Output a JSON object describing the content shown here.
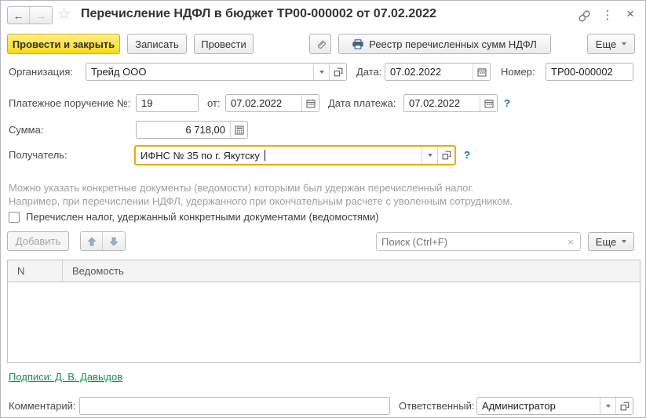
{
  "window": {
    "title": "Перечисление НДФЛ в бюджет ТР00-000002 от 07.02.2022"
  },
  "icons": {
    "back": "←",
    "forward": "→",
    "star": "☆",
    "menu": "⋮",
    "close": "×",
    "help": "?",
    "clear": "×"
  },
  "toolbar": {
    "post_and_close": "Провести и закрыть",
    "write": "Записать",
    "post": "Провести",
    "register_report": "Реестр перечисленных сумм НДФЛ",
    "more": "Еще"
  },
  "fields": {
    "organization": {
      "label": "Организация:",
      "value": "Трейд ООО"
    },
    "date": {
      "label": "Дата:",
      "value": "07.02.2022"
    },
    "number": {
      "label": "Номер:",
      "value": "ТР00-000002"
    },
    "payment_order": {
      "label": "Платежное поручение №:",
      "value": "19"
    },
    "from": {
      "label": "от:",
      "value": "07.02.2022"
    },
    "payment_date": {
      "label": "Дата платежа:",
      "value": "07.02.2022"
    },
    "sum": {
      "label": "Сумма:",
      "value": "6 718,00"
    },
    "recipient": {
      "label": "Получатель:",
      "value": "ИФНС № 35 по г. Якутску"
    },
    "comment": {
      "label": "Комментарий:",
      "value": ""
    },
    "responsible": {
      "label": "Ответственный:",
      "value": "Администратор"
    }
  },
  "info": {
    "line1": "Можно указать конкретные документы (ведомости) которыми был удержан перечисленный налог.",
    "line2": "Например, при перечислении НДФЛ, удержанного при окончательным расчете с уволенным сотрудником."
  },
  "checkbox": {
    "label": "Перечислен налог, удержанный конкретными документами (ведомостями)",
    "checked": false
  },
  "list_section": {
    "add": "Добавить",
    "search_placeholder": "Поиск (Ctrl+F)",
    "more": "Еще"
  },
  "table": {
    "columns": [
      "N",
      "Ведомость"
    ],
    "rows": []
  },
  "signatures": {
    "text": "Подписи: Д. В. Давыдов"
  },
  "colors": {
    "primary_button": "#ffd912",
    "focus_border": "#eeac00",
    "link_green": "#0d9448",
    "help_blue": "#0a6cc9"
  }
}
